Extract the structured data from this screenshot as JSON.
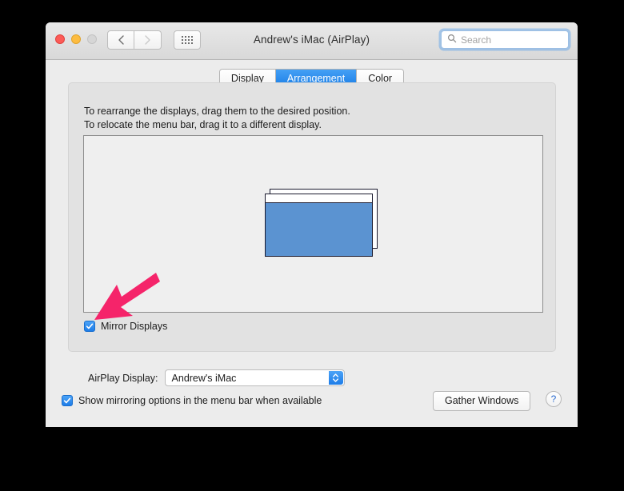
{
  "window": {
    "title": "Andrew's iMac (AirPlay)",
    "traffic_lights": {
      "close": "close-button",
      "minimize": "minimize-button",
      "zoom": "zoom-button"
    },
    "toolbar": {
      "back_icon": "chevron-left-icon",
      "forward_icon": "chevron-right-icon",
      "show_all_icon": "grid-dots-icon"
    },
    "search": {
      "placeholder": "Search",
      "value": "",
      "icon": "search-icon",
      "focused": true
    }
  },
  "tabs": [
    {
      "label": "Display",
      "selected": false
    },
    {
      "label": "Arrangement",
      "selected": true
    },
    {
      "label": "Color",
      "selected": false
    }
  ],
  "panel": {
    "instruction_line_1": "To rearrange the displays, drag them to the desired position.",
    "instruction_line_2": "To relocate the menu bar, drag it to a different display.",
    "displays": [
      {
        "name": "display-back",
        "mirrored": true
      },
      {
        "name": "display-front",
        "has_menu_bar": true,
        "mirrored": true
      }
    ],
    "mirror_displays": {
      "label": "Mirror Displays",
      "checked": true
    }
  },
  "annotation": {
    "type": "arrow",
    "points_to": "Mirror Displays",
    "color": "#f5246a"
  },
  "bottom": {
    "airplay_label": "AirPlay Display:",
    "airplay_value": "Andrew's iMac",
    "airplay_options": [
      "Andrew's iMac"
    ],
    "show_mirroring": {
      "label": "Show mirroring options in the menu bar when available",
      "checked": true
    },
    "gather_windows_label": "Gather Windows",
    "help_label": "?"
  },
  "colors": {
    "accent_blue": "#167ae4",
    "display_screen_blue": "#5b93d1",
    "annotation_pink": "#f5246a",
    "window_background": "#ececec",
    "panel_background": "#e2e2e2",
    "drag_area_background": "#efefef",
    "desktop_background": "#000000"
  }
}
